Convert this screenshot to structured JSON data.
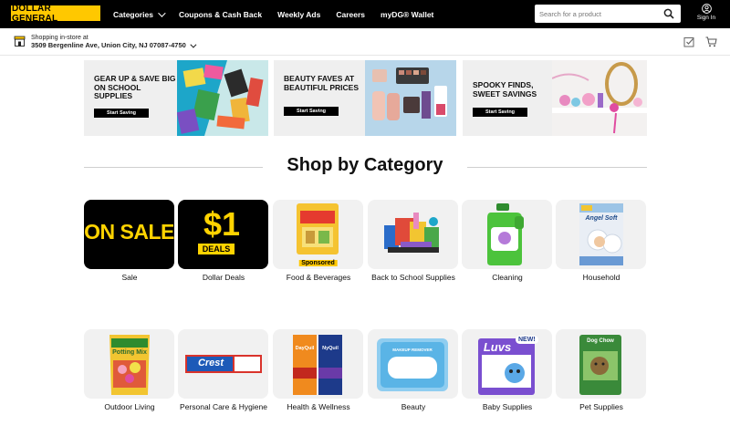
{
  "header": {
    "logo_text": "DOLLAR GENERAL",
    "nav": [
      {
        "label": "Categories",
        "has_dropdown": true
      },
      {
        "label": "Coupons & Cash Back"
      },
      {
        "label": "Weekly Ads"
      },
      {
        "label": "Careers"
      },
      {
        "label": "myDG® Wallet"
      }
    ],
    "search_placeholder": "Search for a product",
    "signin_label": "Sign In"
  },
  "store": {
    "prefix": "Shopping in-store at",
    "address": "3509 Bergenline Ave, Union City, NJ 07087-4750"
  },
  "banners": [
    {
      "text": "GEAR UP & SAVE BIG ON SCHOOL SUPPLIES",
      "button": "Start Saving"
    },
    {
      "text": "BEAUTY FAVES AT BEAUTIFUL PRICES",
      "button": "Start Saving"
    },
    {
      "text": "SPOOKY FINDS, SWEET SAVINGS",
      "button": "Start Saving"
    }
  ],
  "section_title": "Shop by Category",
  "categories": [
    {
      "label": "Sale",
      "tile_text": "ON SALE"
    },
    {
      "label": "Dollar Deals",
      "tile_text_big": "$1",
      "tile_text_small": "DEALS"
    },
    {
      "label": "Food & Beverages",
      "badge": "Sponsored"
    },
    {
      "label": "Back to School Supplies"
    },
    {
      "label": "Cleaning"
    },
    {
      "label": "Household",
      "tile_text": "Angel Soft"
    },
    {
      "label": "Outdoor Living",
      "tile_text": "Potting Mix"
    },
    {
      "label": "Personal Care & Hygiene",
      "tile_text": "Crest"
    },
    {
      "label": "Health & Wellness",
      "tile_text_a": "DayQuil",
      "tile_text_b": "NyQuil"
    },
    {
      "label": "Beauty",
      "tile_text": "MAKEUP REMOVER"
    },
    {
      "label": "Baby Supplies",
      "tile_text": "Luvs",
      "badge": "NEW!"
    },
    {
      "label": "Pet Supplies",
      "tile_text": "Dog Chow"
    }
  ],
  "colors": {
    "brand_yellow": "#ffc800",
    "nav_bg": "#000000"
  }
}
